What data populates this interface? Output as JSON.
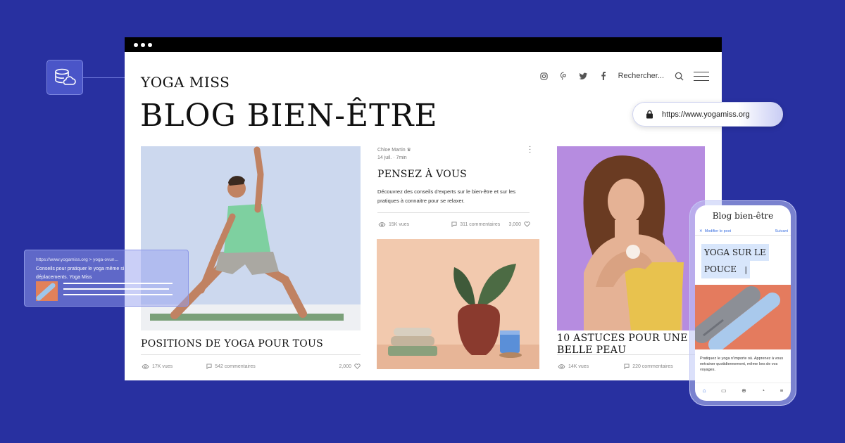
{
  "browser": {
    "site_name": "YOGA MISS",
    "blog_title": "BLOG BIEN-ÊTRE",
    "nav": {
      "social": [
        "instagram",
        "pinterest",
        "twitter",
        "facebook"
      ],
      "search_label": "Rechercher..."
    }
  },
  "posts": [
    {
      "title": "POSITIONS DE YOGA POUR TOUS",
      "views": "17K vues",
      "comments": "542 commentaires",
      "likes": "2,000"
    },
    {
      "author": "Chloe Martin",
      "meta": "14 juil. · 7min",
      "title": "PENSEZ À VOUS",
      "excerpt": "Découvrez des conseils d'experts sur le bien-être et sur les pratiques à connaitre pour se relaxer.",
      "views": "15K vues",
      "comments": "311 commentaires",
      "likes": "3,000"
    },
    {
      "title": "10 ASTUCES POUR UNE BELLE PEAU",
      "views": "14K vues",
      "comments": "220 commentaires"
    }
  ],
  "url_pill": {
    "url": "https://www.yogamiss.org"
  },
  "snippet": {
    "url": "https://www.yogamiss.org > yoga-ovun...",
    "desc": "Conseils pour pratiquer le yoga même si déplacements. Yoga Miss"
  },
  "phone": {
    "title": "Blog bien-être",
    "edit_label": "Modifier le post",
    "next_label": "Suivant",
    "post_line1": "YOGA SUR LE",
    "post_line2": "POUCE",
    "excerpt": "Pratiquez le yoga n'importe où. Apprenez à vous entrainer quotidiennement, même lors de vos voyages."
  },
  "colors": {
    "background": "#2830a0",
    "accent_blue": "#3a6fe0",
    "coral": "#e47b5e",
    "lavender": "#b88de0"
  }
}
